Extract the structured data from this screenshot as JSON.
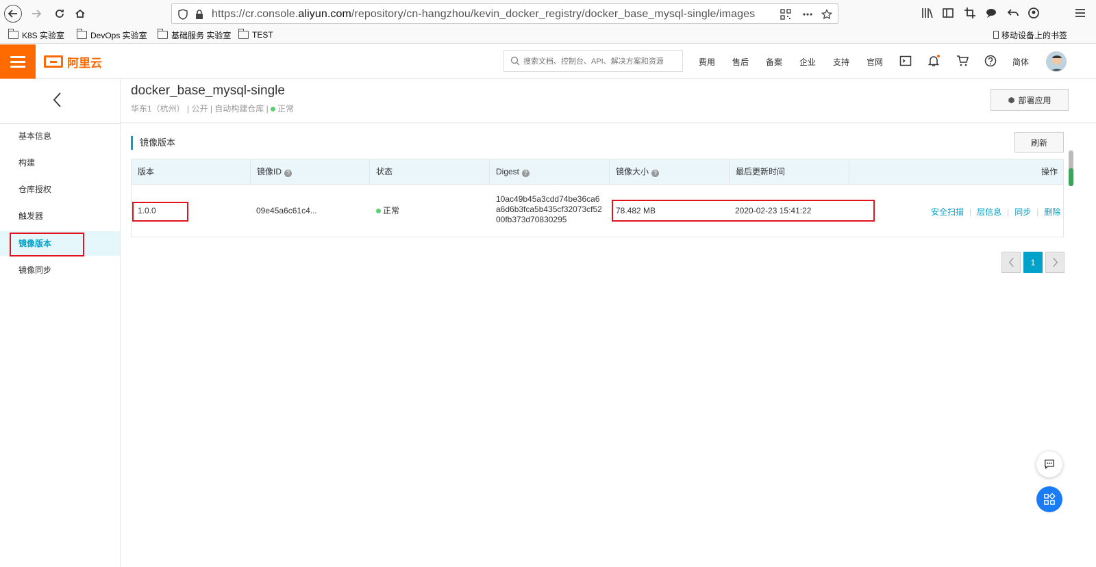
{
  "browser": {
    "url_prefix": "https://cr.console.",
    "url_domain": "aliyun.com",
    "url_path": "/repository/cn-hangzhou/kevin_docker_registry/docker_base_mysql-single/images",
    "bookmarks": [
      "K8S 实验室",
      "DevOps 实验室",
      "基础服务 实验室",
      "TEST"
    ],
    "mobile_bookmarks": "移动设备上的书签"
  },
  "topbar": {
    "logo_text": "阿里云",
    "search_placeholder": "搜索文档、控制台、API、解决方案和资源",
    "links": [
      "费用",
      "售后",
      "备案",
      "企业",
      "支持",
      "官网"
    ],
    "lang": "简体",
    "accent_color": "#ff6a00"
  },
  "sidebar": {
    "items": [
      {
        "label": "基本信息"
      },
      {
        "label": "构建"
      },
      {
        "label": "仓库授权"
      },
      {
        "label": "触发器"
      },
      {
        "label": "镜像版本"
      },
      {
        "label": "镜像同步"
      }
    ],
    "active_index": 4
  },
  "repo": {
    "name": "docker_base_mysql-single",
    "region": "华东1（杭州）",
    "visibility": "公开",
    "build_type": "自动构建仓库",
    "status": "正常",
    "deploy_label": "部署应用"
  },
  "section": {
    "title": "镜像版本",
    "refresh_label": "刷新"
  },
  "table": {
    "columns": [
      "版本",
      "镜像ID",
      "状态",
      "Digest",
      "镜像大小",
      "最后更新时间",
      "操作"
    ],
    "rows": [
      {
        "version": "1.0.0",
        "image_id": "09e45a6c61c4...",
        "status": "正常",
        "digest_1": "10ac49b45a3cdd74be36ca6",
        "digest_2": "a6d6b3fca5b435cf32073cf52",
        "digest_3": "00fb373d70830295",
        "size": "78.482 MB",
        "updated": "2020-02-23 15:41:22",
        "ops": [
          "安全扫描",
          "层信息",
          "同步",
          "删除"
        ]
      }
    ]
  },
  "pagination": {
    "current": "1"
  },
  "colors": {
    "link": "#00a2ca",
    "status_ok": "#5bd171",
    "highlight": "#e0141e"
  }
}
